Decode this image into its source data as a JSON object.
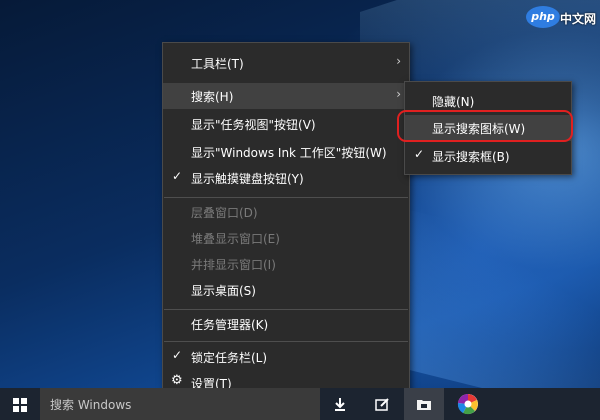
{
  "watermark": {
    "logo_text": "php",
    "site_text": "中文网"
  },
  "main_menu": {
    "items": [
      {
        "label": "工具栏(T)",
        "has_submenu": true,
        "checked": false,
        "disabled": false
      },
      {
        "label": "搜索(H)",
        "has_submenu": true,
        "checked": false,
        "disabled": false,
        "hover": true
      },
      {
        "label": "显示\"任务视图\"按钮(V)",
        "has_submenu": false,
        "checked": false,
        "disabled": false
      },
      {
        "label": "显示\"Windows Ink 工作区\"按钮(W)",
        "has_submenu": false,
        "checked": false,
        "disabled": false
      },
      {
        "label": "显示触摸键盘按钮(Y)",
        "has_submenu": false,
        "checked": true,
        "disabled": false
      },
      {
        "label": "层叠窗口(D)",
        "disabled": true
      },
      {
        "label": "堆叠显示窗口(E)",
        "disabled": true
      },
      {
        "label": "并排显示窗口(I)",
        "disabled": true
      },
      {
        "label": "显示桌面(S)",
        "disabled": false
      },
      {
        "label": "任务管理器(K)",
        "disabled": false
      },
      {
        "label": "锁定任务栏(L)",
        "checked": true,
        "disabled": false
      },
      {
        "label": "设置(T)",
        "icon": "gear-icon",
        "disabled": false
      }
    ]
  },
  "search_submenu": {
    "items": [
      {
        "label": "隐藏(N)",
        "checked": false
      },
      {
        "label": "显示搜索图标(W)",
        "checked": false,
        "hover": true
      },
      {
        "label": "显示搜索框(B)",
        "checked": true
      }
    ]
  },
  "taskbar": {
    "search_placeholder": "搜索 Windows",
    "pinned_icons": [
      "download-app-icon",
      "edit-app-icon",
      "file-explorer-icon",
      "color-app-icon"
    ]
  },
  "colors": {
    "menu_bg": "#2b2b2b",
    "hover_bg": "#414141",
    "highlight_ring": "#e02020",
    "taskbar_bg": "#1c2430"
  },
  "glyphs": {
    "check": "✓",
    "arrow": "›",
    "gear": "⚙"
  }
}
